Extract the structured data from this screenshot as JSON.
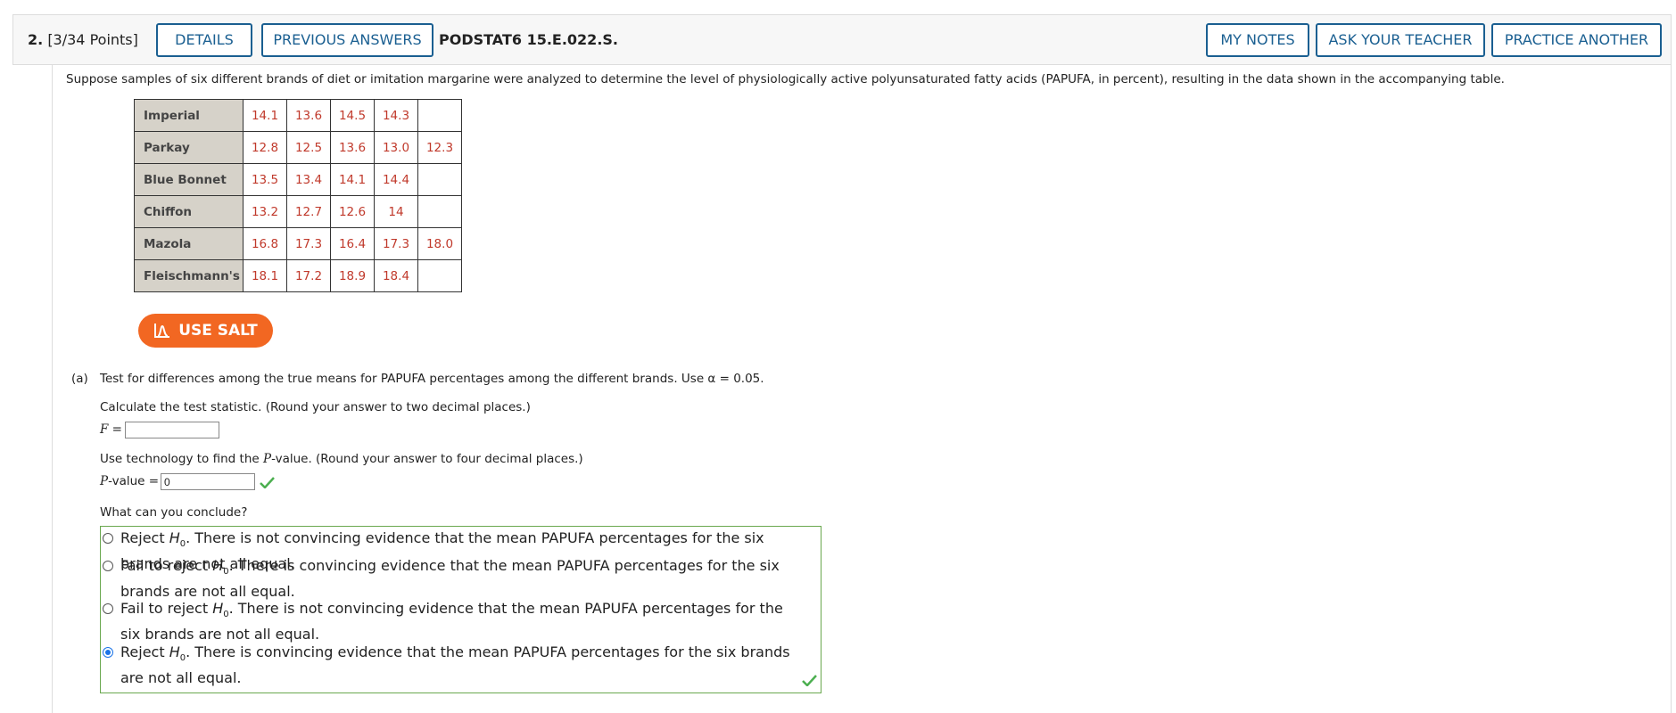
{
  "header": {
    "question_number": "2.",
    "points": "[3/34 Points]",
    "details_label": "DETAILS",
    "previous_answers_label": "PREVIOUS ANSWERS",
    "question_code": "PODSTAT6 15.E.022.S.",
    "my_notes_label": "MY NOTES",
    "ask_teacher_label": "ASK YOUR TEACHER",
    "practice_another_label": "PRACTICE ANOTHER"
  },
  "intro": "Suppose samples of six different brands of diet or imitation margarine were analyzed to determine the level of physiologically active polyunsaturated fatty acids (PAPUFA, in percent), resulting in the data shown in the accompanying table.",
  "table": [
    {
      "brand": "Imperial",
      "values": [
        "14.1",
        "13.6",
        "14.5",
        "14.3",
        ""
      ]
    },
    {
      "brand": "Parkay",
      "values": [
        "12.8",
        "12.5",
        "13.6",
        "13.0",
        "12.3"
      ]
    },
    {
      "brand": "Blue Bonnet",
      "values": [
        "13.5",
        "13.4",
        "14.1",
        "14.4",
        ""
      ]
    },
    {
      "brand": "Chiffon",
      "values": [
        "13.2",
        "12.7",
        "12.6",
        "14",
        ""
      ]
    },
    {
      "brand": "Mazola",
      "values": [
        "16.8",
        "17.3",
        "16.4",
        "17.3",
        "18.0"
      ]
    },
    {
      "brand": "Fleischmann's",
      "values": [
        "18.1",
        "17.2",
        "18.9",
        "18.4",
        ""
      ]
    }
  ],
  "salt_label": "USE SALT",
  "part_a": {
    "label": "(a)",
    "prompt": "Test for differences among the true means for PAPUFA percentages among the different brands. Use α = 0.05.",
    "calc_instruction": "Calculate the test statistic. (Round your answer to two decimal places.)",
    "f_label": "F =",
    "f_value": "",
    "p_instruction_pre": "Use technology to find the ",
    "p_instruction_italic": "P",
    "p_instruction_post": "-value. (Round your answer to four decimal places.)",
    "p_label_italic": "P",
    "p_label_rest": "-value =",
    "p_value": "0",
    "conclude_prompt": "What can you conclude?",
    "options": [
      {
        "pre": "Reject ",
        "post": ". There is not convincing evidence that the mean PAPUFA percentages for the six brands are not all equal.",
        "selected": false
      },
      {
        "pre": "Fail to reject ",
        "post": ". There is convincing evidence that the mean PAPUFA percentages for the six brands are not all equal.",
        "selected": false
      },
      {
        "pre": "Fail to reject ",
        "post": ". There is not convincing evidence that the mean PAPUFA percentages for the six brands are not all equal.",
        "selected": false
      },
      {
        "pre": "Reject ",
        "post": ". There is convincing evidence that the mean PAPUFA percentages for the six brands are not all equal.",
        "selected": true
      }
    ],
    "h_symbol": "H",
    "h_sub": "0"
  },
  "colors": {
    "accent_blue": "#1a5f91",
    "salt_orange": "#f26722",
    "value_red": "#c0392b",
    "check_green": "#4caf50"
  }
}
